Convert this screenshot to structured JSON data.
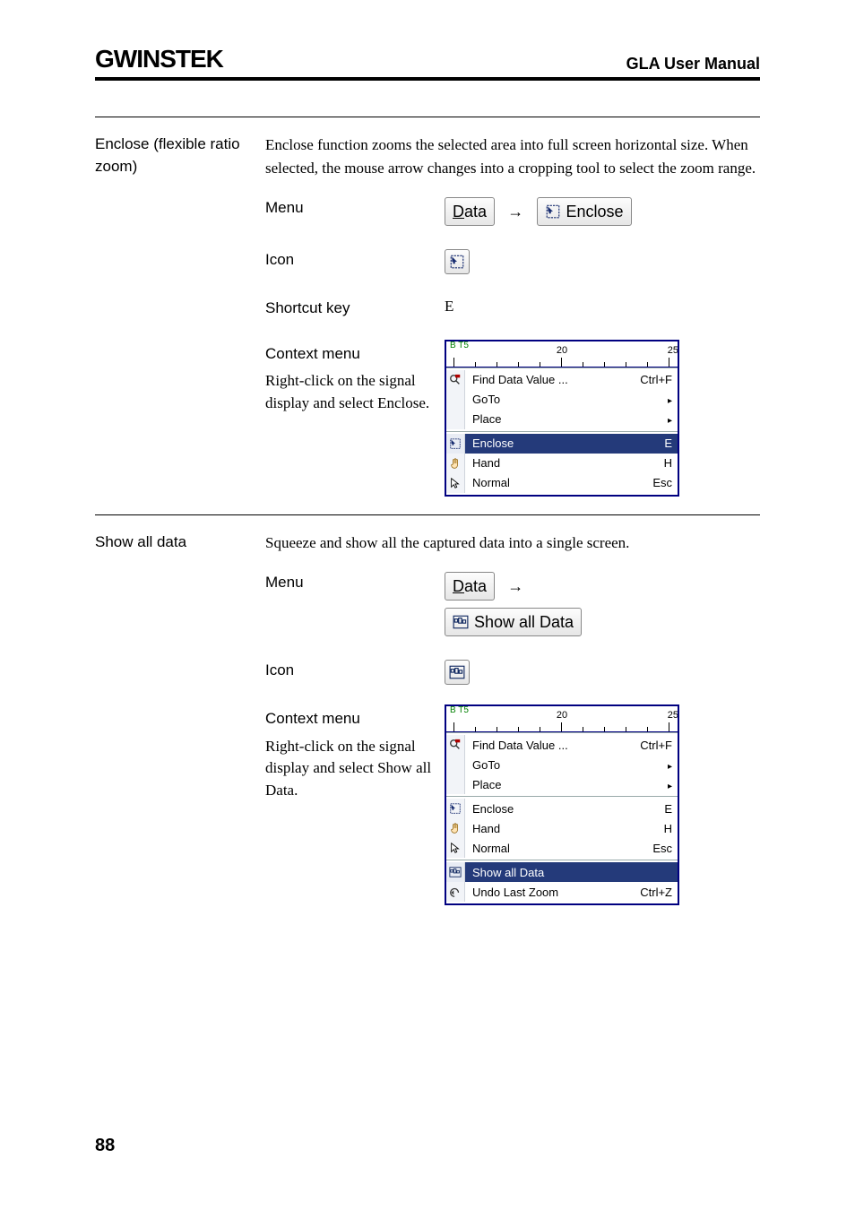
{
  "header": {
    "logo": "GWINSTEK",
    "manual": "GLA User Manual"
  },
  "sections": {
    "enclose": {
      "title": "Enclose (flexible ratio zoom)",
      "desc": "Enclose function zooms the selected area into full screen horizontal size. When selected, the mouse arrow changes into a cropping tool to select the zoom range.",
      "rows": {
        "menu_label": "Menu",
        "menu_path_1": "Data",
        "menu_path_2": "Enclose",
        "icon_label": "Icon",
        "shortcut_label": "Shortcut key",
        "shortcut_value": "E",
        "context_label": "Context menu",
        "context_desc": "Right-click on the signal display and select Enclose."
      },
      "ctx": {
        "ruler_bt": "B\nT5",
        "ruler_center": "20",
        "ruler_right": "25",
        "items": [
          {
            "icon": "find-icon",
            "text": "Find Data Value ...",
            "acc": "Ctrl+F"
          },
          {
            "icon": "",
            "text": "GoTo",
            "sub": true
          },
          {
            "icon": "",
            "text": "Place",
            "sub": true
          }
        ],
        "items2": [
          {
            "icon": "enclose-icon",
            "text": "Enclose",
            "acc": "E",
            "sel": true
          },
          {
            "icon": "hand-icon",
            "text": "Hand",
            "acc": "H"
          },
          {
            "icon": "pointer-icon",
            "text": "Normal",
            "acc": "Esc"
          }
        ]
      }
    },
    "showall": {
      "title": "Show all data",
      "desc": "Squeeze and show all the captured data into a single screen.",
      "rows": {
        "menu_label": "Menu",
        "menu_path_1": "Data",
        "menu_path_2": "Show all Data",
        "icon_label": "Icon",
        "context_label": "Context menu",
        "context_desc": "Right-click on the signal display and select Show all Data."
      },
      "ctx": {
        "ruler_bt": "B\nT5",
        "ruler_center": "20",
        "ruler_right": "25",
        "items": [
          {
            "icon": "find-icon",
            "text": "Find Data Value ...",
            "acc": "Ctrl+F"
          },
          {
            "icon": "",
            "text": "GoTo",
            "sub": true
          },
          {
            "icon": "",
            "text": "Place",
            "sub": true
          }
        ],
        "items2": [
          {
            "icon": "enclose-icon",
            "text": "Enclose",
            "acc": "E"
          },
          {
            "icon": "hand-icon",
            "text": "Hand",
            "acc": "H"
          },
          {
            "icon": "pointer-icon",
            "text": "Normal",
            "acc": "Esc"
          }
        ],
        "items3": [
          {
            "icon": "showall-icon",
            "text": "Show all Data",
            "acc": "",
            "sel": true
          },
          {
            "icon": "undo-icon",
            "text": "Undo Last Zoom",
            "acc": "Ctrl+Z"
          }
        ]
      }
    }
  },
  "page_number": "88"
}
